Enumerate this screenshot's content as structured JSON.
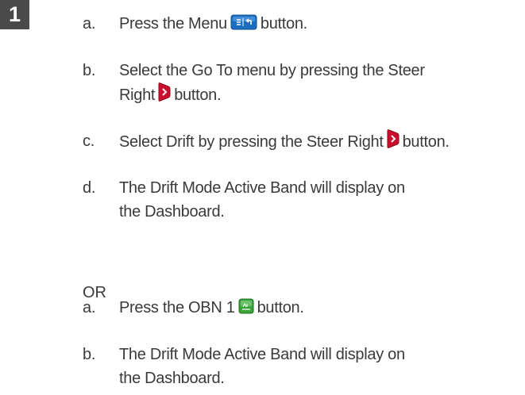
{
  "step_number": "1",
  "section1": {
    "a": {
      "letter": "a.",
      "before": "Press the Menu",
      "after": "button.",
      "icon": "menu-button-icon",
      "icon_color": "#1c6fc0"
    },
    "b": {
      "letter": "b.",
      "line1": "Select the Go To menu by pressing the Steer",
      "line2_before": "Right",
      "line2_after": "button.",
      "icon": "steer-right-button-icon",
      "icon_color": "#c8102e"
    },
    "c": {
      "letter": "c.",
      "before": "Select Drift by pressing the Steer Right",
      "after": "button.",
      "icon": "steer-right-button-icon",
      "icon_color": "#c8102e"
    },
    "d": {
      "letter": "d.",
      "line1": "The Drift Mode Active Band will display on",
      "line2": "the Dashboard."
    }
  },
  "or_label": "OR",
  "section2": {
    "a": {
      "letter": "a.",
      "before": "Press the OBN 1",
      "after": "button.",
      "icon": "obn-1-button-icon",
      "icon_color": "#3aa53a"
    },
    "b": {
      "letter": "b.",
      "line1": "The Drift Mode Active Band will display on",
      "line2": "the Dashboard."
    }
  }
}
